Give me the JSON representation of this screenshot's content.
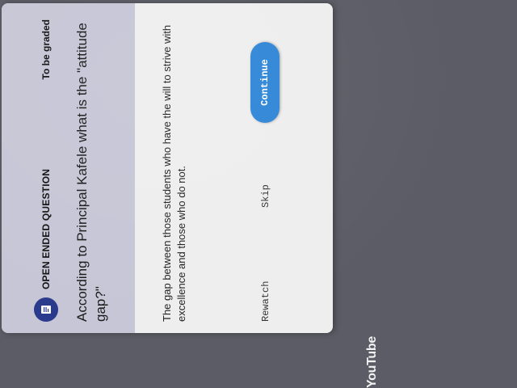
{
  "question": {
    "type_label": "OPEN ENDED QUESTION",
    "grading_label": "To be graded",
    "text": "According to Principal Kafele what is the \"attitude gap?\""
  },
  "answer": {
    "text": "The gap between those students who have the will to strive with excellence and those who do not."
  },
  "actions": {
    "rewatch_label": "Rewatch",
    "skip_label": "Skip",
    "continue_label": "Continue"
  },
  "brand": {
    "name": "YouTube"
  },
  "icons": {
    "question": "question-doc-icon"
  },
  "colors": {
    "accent": "#2f86d6",
    "icon_bg": "#2a3a8c",
    "header_bg": "#c6c6d6"
  }
}
